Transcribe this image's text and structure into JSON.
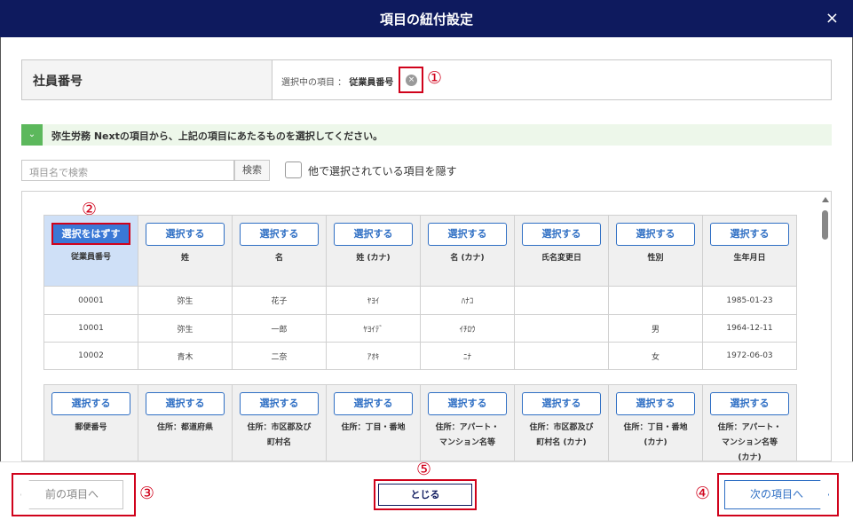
{
  "dialog": {
    "title": "項目の紐付設定",
    "close_glyph": "×"
  },
  "header": {
    "label": "社員番号",
    "selected_prefix": "選択中の項目 ：",
    "selected_value": "従業員番号",
    "clear_glyph": "×",
    "marker": "①"
  },
  "info": {
    "icon": "⌄",
    "text": "弥生労務 Nextの項目から、上記の項目にあたるものを選択してください。"
  },
  "search": {
    "placeholder": "項目名で検索",
    "button": "検索",
    "hide_label": "他で選択されている項目を隠す"
  },
  "table1": {
    "marker": "②",
    "selected_button": "選択をはずす",
    "button": "選択する",
    "columns": [
      "従業員番号",
      "姓",
      "名",
      "姓 (カナ)",
      "名 (カナ)",
      "氏名変更日",
      "性別",
      "生年月日"
    ],
    "rows": [
      [
        "00001",
        "弥生",
        "花子",
        "ﾔﾖｲ",
        "ﾊﾅｺ",
        "",
        "",
        "1985-01-23"
      ],
      [
        "10001",
        "弥生",
        "一郎",
        "ﾔﾖｲﾃﾞ",
        "ｲﾁﾛｳ",
        "",
        "男",
        "1964-12-11"
      ],
      [
        "10002",
        "青木",
        "二奈",
        "ｱｵｷ",
        "ﾆﾅ",
        "",
        "女",
        "1972-06-03"
      ]
    ]
  },
  "table2": {
    "button": "選択する",
    "columns": [
      [
        "郵便番号"
      ],
      [
        "住所：都道府県"
      ],
      [
        "住所：市区郡及び",
        "町村名"
      ],
      [
        "住所：丁目・番地"
      ],
      [
        "住所：アパート・",
        "マンション名等"
      ],
      [
        "住所：市区郡及び",
        "町村名 (カナ)"
      ],
      [
        "住所：丁目・番地",
        "(カナ)"
      ],
      [
        "住所：アパート・",
        "マンション名等",
        "(カナ)"
      ]
    ]
  },
  "footer": {
    "prev": "前の項目へ",
    "prev_marker": "③",
    "close": "とじる",
    "close_marker": "⑤",
    "next": "次の項目へ",
    "next_marker": "④"
  }
}
